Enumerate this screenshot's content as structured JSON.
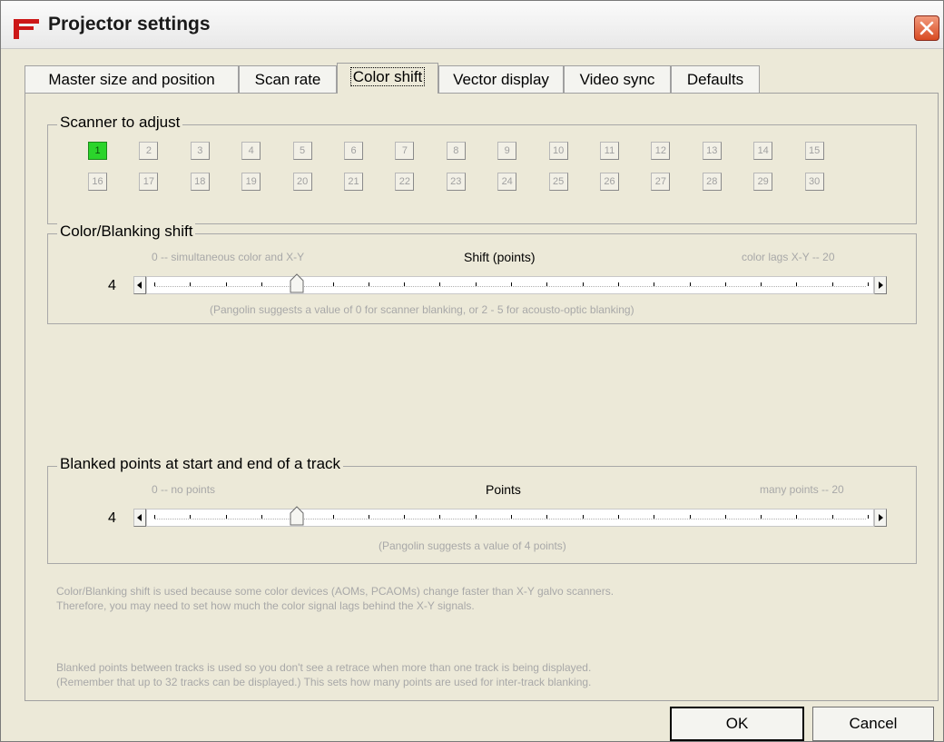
{
  "window": {
    "title": "Projector settings",
    "icons": {
      "app": "projector-app-icon",
      "close": "close-icon"
    }
  },
  "tabs": [
    {
      "label": "Master size and position",
      "active": false
    },
    {
      "label": "Scan rate",
      "active": false
    },
    {
      "label": "Color shift",
      "active": true
    },
    {
      "label": "Vector display",
      "active": false
    },
    {
      "label": "Video sync",
      "active": false
    },
    {
      "label": "Defaults",
      "active": false
    }
  ],
  "scanner_group": {
    "label": "Scanner to adjust",
    "scanners": [
      "1",
      "2",
      "3",
      "4",
      "5",
      "6",
      "7",
      "8",
      "9",
      "10",
      "11",
      "12",
      "13",
      "14",
      "15",
      "16",
      "17",
      "18",
      "19",
      "20",
      "21",
      "22",
      "23",
      "24",
      "25",
      "26",
      "27",
      "28",
      "29",
      "30"
    ],
    "selected": "1",
    "selected_color": "#2bd42b"
  },
  "color_shift": {
    "label": "Color/Blanking shift",
    "left_hint": "0 -- simultaneous color and X-Y",
    "center_label": "Shift (points)",
    "right_hint": "color lags X-Y -- 20",
    "value": "4",
    "min": 0,
    "max": 20,
    "position": 4,
    "suggestion": "(Pangolin suggests a value of 0 for scanner blanking, or 2 - 5 for acousto-optic blanking)"
  },
  "blanked_points": {
    "label": "Blanked points at start and end of a track",
    "left_hint": "0 -- no points",
    "center_label": "Points",
    "right_hint": "many points -- 20",
    "value": "4",
    "min": 0,
    "max": 20,
    "position": 4,
    "suggestion": "(Pangolin suggests a value of 4 points)"
  },
  "info": {
    "color_shift_line1": "Color/Blanking shift is used because some color devices (AOMs, PCAOMs) change faster than X-Y galvo scanners.",
    "color_shift_line2": "Therefore, you may need to set how much the color signal lags behind the X-Y signals.",
    "blanked_line1": "Blanked points between tracks is used so you don't see a retrace when more than one track is being displayed.",
    "blanked_line2": "(Remember that up to 32 tracks can be displayed.) This sets how many points are used for inter-track blanking."
  },
  "buttons": {
    "ok": "OK",
    "cancel": "Cancel"
  }
}
